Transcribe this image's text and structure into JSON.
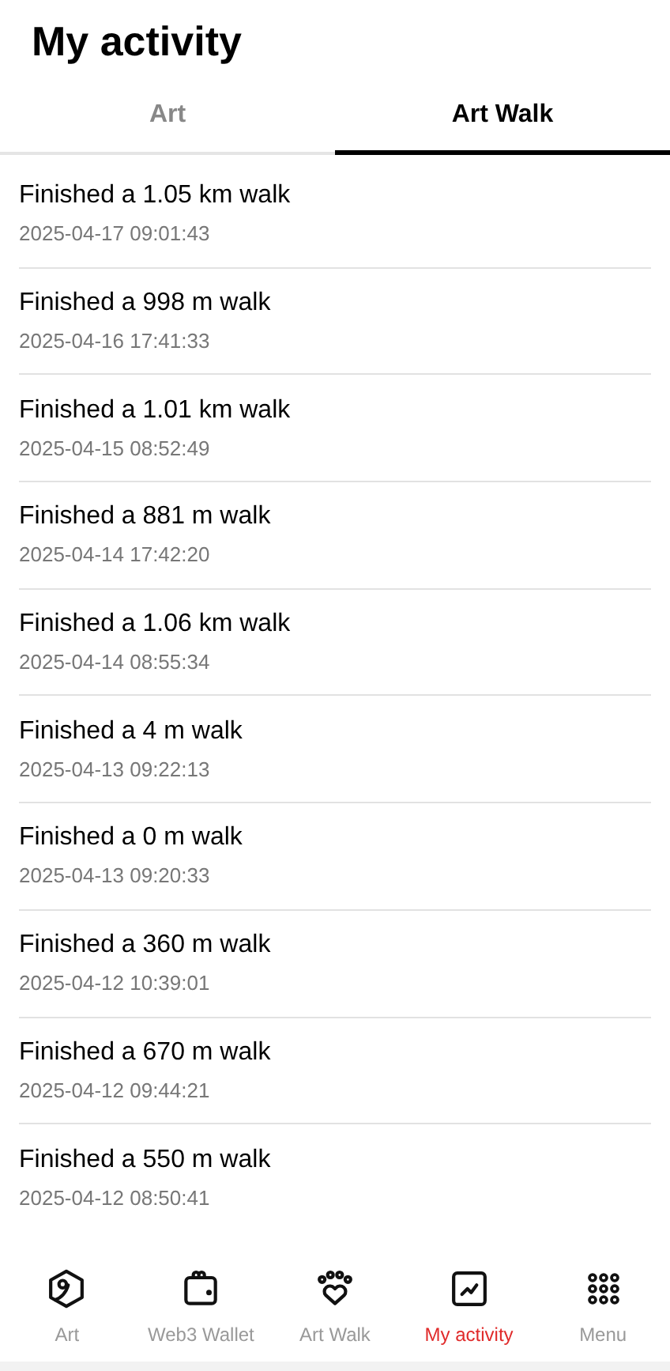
{
  "header": {
    "title": "My activity"
  },
  "tabs": [
    {
      "label": "Art",
      "selected": false
    },
    {
      "label": "Art Walk",
      "selected": true
    }
  ],
  "activities": [
    {
      "title": "Finished a 1.05 km walk",
      "time": "2025-04-17 09:01:43"
    },
    {
      "title": "Finished a 998 m walk",
      "time": "2025-04-16 17:41:33"
    },
    {
      "title": "Finished a 1.01 km walk",
      "time": "2025-04-15 08:52:49"
    },
    {
      "title": "Finished a 881 m walk",
      "time": "2025-04-14 17:42:20"
    },
    {
      "title": "Finished a 1.06 km walk",
      "time": "2025-04-14 08:55:34"
    },
    {
      "title": "Finished a 4 m walk",
      "time": "2025-04-13 09:22:13"
    },
    {
      "title": "Finished a 0 m walk",
      "time": "2025-04-13 09:20:33"
    },
    {
      "title": "Finished a 360 m walk",
      "time": "2025-04-12 10:39:01"
    },
    {
      "title": "Finished a 670 m walk",
      "time": "2025-04-12 09:44:21"
    },
    {
      "title": "Finished a 550 m walk",
      "time": "2025-04-12 08:50:41"
    }
  ],
  "bottom_nav": [
    {
      "kind": "art",
      "label": "Art",
      "selected": false
    },
    {
      "kind": "wallet",
      "label": "Web3 Wallet",
      "selected": false
    },
    {
      "kind": "paw",
      "label": "Art Walk",
      "selected": false
    },
    {
      "kind": "activity",
      "label": "My activity",
      "selected": true
    },
    {
      "kind": "menu",
      "label": "Menu",
      "selected": false
    }
  ]
}
